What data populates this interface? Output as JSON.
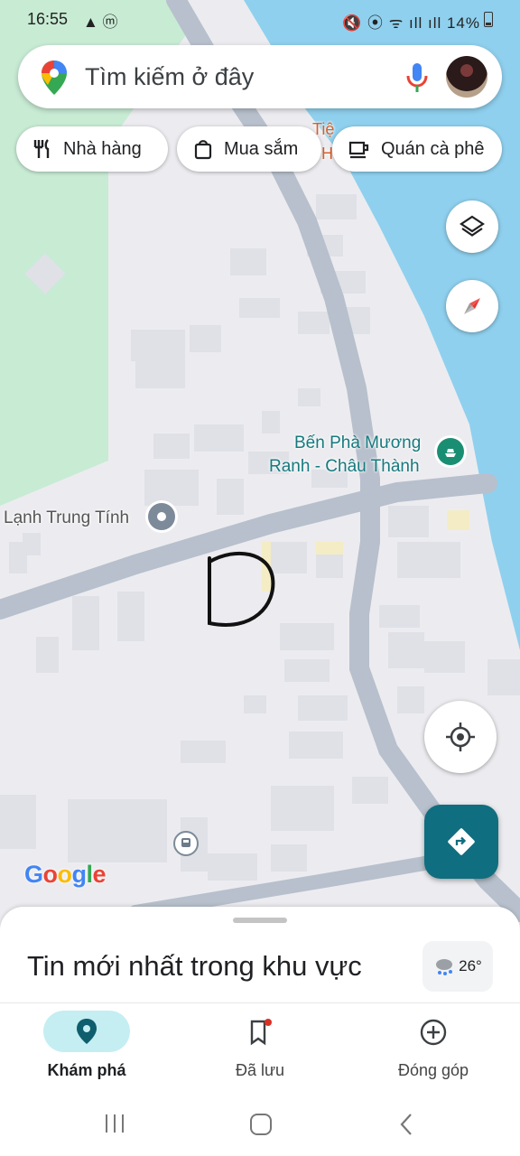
{
  "status_bar": {
    "time": "16:55",
    "battery": "14%"
  },
  "search": {
    "placeholder": "Tìm kiếm ở đây"
  },
  "chips": [
    {
      "label": "Nhà hàng",
      "icon": "restaurant-icon"
    },
    {
      "label": "Mua sắm",
      "icon": "shopping-bag-icon"
    },
    {
      "label": "Quán cà phê",
      "icon": "coffee-icon"
    }
  ],
  "map": {
    "labels": {
      "ferry_line1": "Bến Phà Mương",
      "ferry_line2": "Ranh - Châu Thành",
      "place": "Lạnh Trung Tính",
      "partial_top": "Tiệ",
      "partial_top2": "H"
    },
    "logo": "Google",
    "colors": {
      "water": "#8fd0ee",
      "park": "#c8ebd4",
      "road": "#b7c0cc",
      "land": "#ececf0",
      "accent": "#0f6e7f"
    }
  },
  "sheet": {
    "title": "Tin mới nhất trong khu vực",
    "temperature": "26°"
  },
  "bottom_nav": [
    {
      "label": "Khám phá",
      "icon": "explore-pin-icon",
      "active": true
    },
    {
      "label": "Đã lưu",
      "icon": "bookmark-icon",
      "active": false
    },
    {
      "label": "Đóng góp",
      "icon": "add-circle-icon",
      "active": false
    }
  ]
}
